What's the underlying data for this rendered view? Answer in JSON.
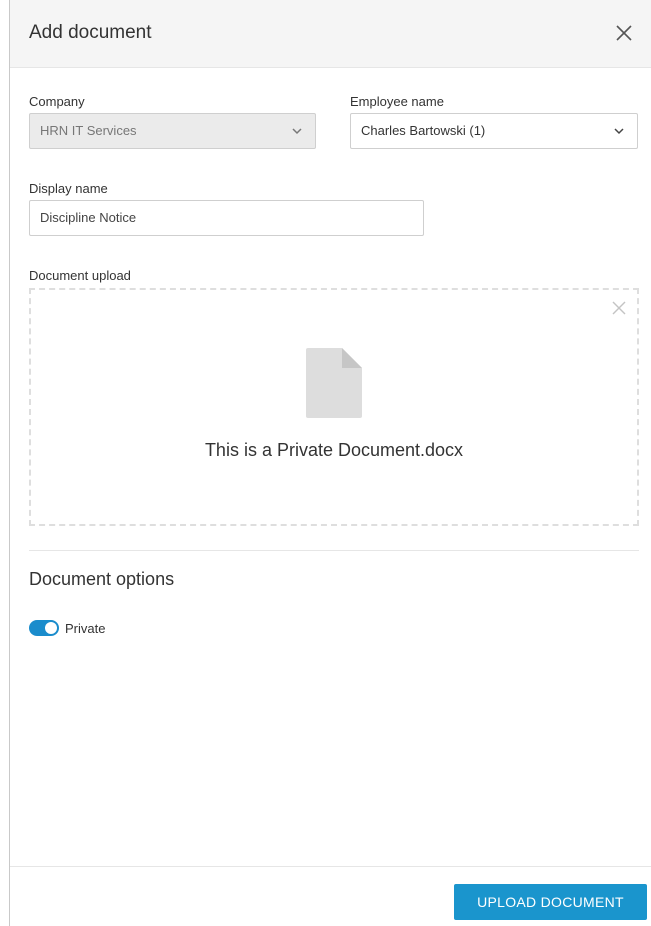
{
  "dialog": {
    "title": "Add document",
    "close_icon": "close-icon"
  },
  "form": {
    "company": {
      "label": "Company",
      "value": "HRN IT Services",
      "disabled": true
    },
    "employee": {
      "label": "Employee name",
      "value": "Charles Bartowski (1)"
    },
    "display_name": {
      "label": "Display name",
      "value": "Discipline Notice"
    },
    "upload": {
      "label": "Document upload",
      "file_name": "This is a Private Document.docx",
      "file_icon": "document-icon",
      "remove_icon": "close-icon"
    }
  },
  "options": {
    "title": "Document options",
    "private": {
      "label": "Private",
      "checked": true
    }
  },
  "footer": {
    "upload_label": "UPLOAD DOCUMENT"
  },
  "colors": {
    "accent": "#1a95cd",
    "toggle_on": "#1a8ccc",
    "header_bg": "#f5f5f5"
  }
}
